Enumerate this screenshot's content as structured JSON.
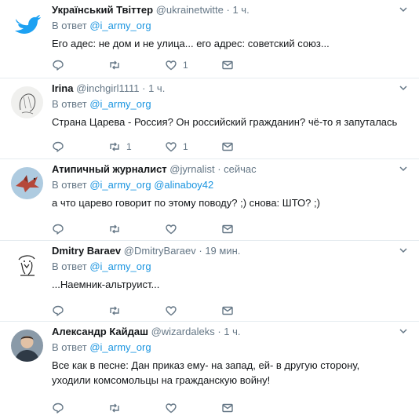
{
  "reply_prefix": "В ответ",
  "tweets": [
    {
      "name": "Український Твіттер",
      "handle": "@ukrainetwitte",
      "time": "1 ч.",
      "reply_to": [
        "@i_army_org"
      ],
      "text": "Его адес: не дом и не улица... его адрес: советский союз...",
      "like_count": "1",
      "retweet_count": "",
      "avatar_icon": "twitter-bird-icon"
    },
    {
      "name": "Irina",
      "handle": "@inchgirl1111",
      "time": "1 ч.",
      "reply_to": [
        "@i_army_org"
      ],
      "text": "Страна Царева - Россия? Он российский гражданин? чё-то я запуталась",
      "like_count": "1",
      "retweet_count": "1",
      "avatar_icon": "face-sketch-avatar"
    },
    {
      "name": "Атипичный журналист",
      "handle": "@jyrnalist",
      "time": "сейчас",
      "reply_to": [
        "@i_army_org",
        "@alinaboy42"
      ],
      "text": "а что царево говорит по этому поводу? ;) снова: ШТО? ;)",
      "like_count": "",
      "retweet_count": "",
      "avatar_icon": "dragon-avatar"
    },
    {
      "name": "Dmitry Baraev",
      "handle": "@DmitryBaraev",
      "time": "19 мин.",
      "reply_to": [
        "@i_army_org"
      ],
      "text": "...Наемник-альтруист...",
      "like_count": "",
      "retweet_count": "",
      "avatar_icon": "drawing-avatar"
    },
    {
      "name": "Александр Кайдаш",
      "handle": "@wizardaleks",
      "time": "1 ч.",
      "reply_to": [
        "@i_army_org"
      ],
      "text": "Все как в песне: Дан приказ ему- на запад, ей- в другую сторону, уходили комсомольцы на гражданскую войну!",
      "like_count": "",
      "retweet_count": "",
      "avatar_icon": "photo-avatar"
    }
  ],
  "colors": {
    "link": "#1b95e0",
    "muted": "#657786",
    "text": "#14171a",
    "twitter_blue": "#1da1f2"
  }
}
